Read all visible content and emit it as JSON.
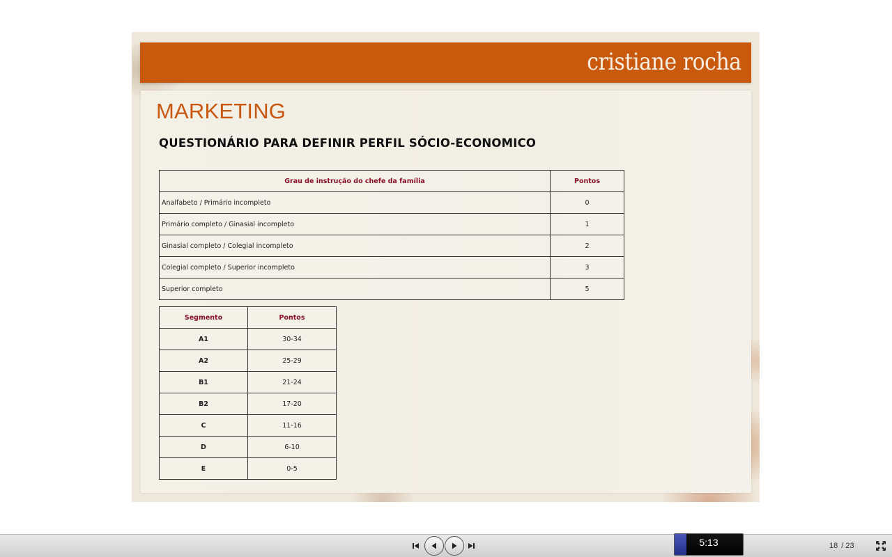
{
  "slide": {
    "brand": "cristiane rocha",
    "title": "MARKETING",
    "subtitle": "QUESTIONÁRIO PARA DEFINIR PERFIL SÓCIO-ECONOMICO",
    "education_table": {
      "headers": [
        "Grau de instrução do chefe da família",
        "Pontos"
      ],
      "rows": [
        {
          "criterion": "Analfabeto / Primário incompleto",
          "points": "0"
        },
        {
          "criterion": "Primário completo / Ginasial incompleto",
          "points": "1"
        },
        {
          "criterion": "Ginasial completo / Colegial incompleto",
          "points": "2"
        },
        {
          "criterion": "Colegial completo / Superior incompleto",
          "points": "3"
        },
        {
          "criterion": "Superior completo",
          "points": "5"
        }
      ]
    },
    "segment_table": {
      "headers": [
        "Segmento",
        "Pontos"
      ],
      "rows": [
        {
          "segment": "A1",
          "points": "30-34"
        },
        {
          "segment": "A2",
          "points": "25-29"
        },
        {
          "segment": "B1",
          "points": "21-24"
        },
        {
          "segment": "B2",
          "points": "17-20"
        },
        {
          "segment": "C",
          "points": "11-16"
        },
        {
          "segment": "D",
          "points": "6-10"
        },
        {
          "segment": "E",
          "points": "0-5"
        }
      ]
    }
  },
  "toolbar": {
    "time": "5:13",
    "time_progress": 0.17,
    "current_page": "18",
    "total_pages": "/ 23",
    "icons": {
      "first": "skip-to-first-icon",
      "prev": "previous-icon",
      "next": "next-icon",
      "last": "skip-to-last-icon",
      "fullscreen": "fullscreen-icon"
    },
    "colors": {
      "progress": "#2f3a9c",
      "accent": "#c95a0d",
      "table_header": "#8a0f2a"
    }
  }
}
